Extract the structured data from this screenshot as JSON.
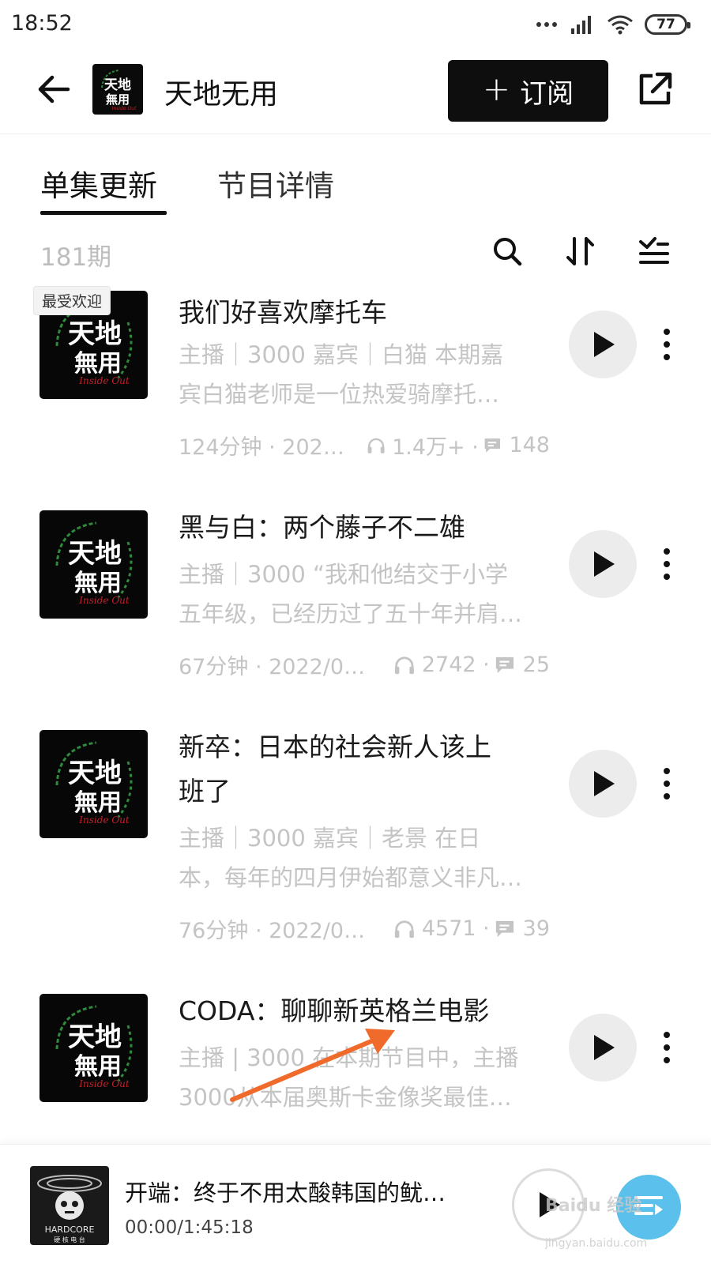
{
  "status_bar": {
    "time": "18:52",
    "battery": "77"
  },
  "header": {
    "title": "天地无用",
    "subscribe_label": "订阅"
  },
  "tabs": [
    {
      "label": "单集更新",
      "active": true
    },
    {
      "label": "节目详情",
      "active": false
    }
  ],
  "toolbar": {
    "episode_count": "181期",
    "icons": [
      "search-icon",
      "sort-icon",
      "filter-list-icon"
    ]
  },
  "episodes": [
    {
      "badge": "最受欢迎",
      "title_lines": [
        "我们好喜欢摩托车"
      ],
      "desc_lines": [
        "主播｜3000 嘉宾｜白猫 本期嘉",
        "宾白猫老师是一位热爱骑摩托…"
      ],
      "duration_date": "124分钟 · 202…",
      "plays": "1.4万+ ·",
      "comments": "148"
    },
    {
      "title_lines": [
        "黑与白：两个藤子不二雄"
      ],
      "desc_lines": [
        "主播｜3000 “我和他结交于小学",
        "五年级，已经历过了五十年并肩…"
      ],
      "duration_date": "67分钟 · 2022/0…",
      "plays": "2742 ·",
      "comments": "25"
    },
    {
      "title_lines": [
        "新卒：日本的社会新人该上",
        "班了"
      ],
      "desc_lines": [
        "主播｜3000 嘉宾｜老景 在日",
        "本，每年的四月伊始都意义非凡…"
      ],
      "duration_date": "76分钟 · 2022/0…",
      "plays": "4571 ·",
      "comments": "39"
    },
    {
      "title_lines": [
        "CODA：聊聊新英格兰电影"
      ],
      "desc_lines": [
        "主播 | 3000 在本期节目中，主播",
        "3000从本届奥斯卡金像奖最佳…"
      ]
    }
  ],
  "cover_text": {
    "line1": "天地",
    "line2": "無用",
    "sub": "Inside Out"
  },
  "mini_player": {
    "title": "开端：终于不用太酸韩国的鱿…",
    "time": "00:00/1:45:18",
    "cover_text": "HARDCORE",
    "cover_sub": "硬 核 电 台"
  },
  "watermark": {
    "main": "Baidu 经验",
    "sub": "jingyan.baidu.com"
  },
  "colors": {
    "accent": "#0e0e0e",
    "muted": "#c4c4c4",
    "arrow": "#f06a2c"
  }
}
